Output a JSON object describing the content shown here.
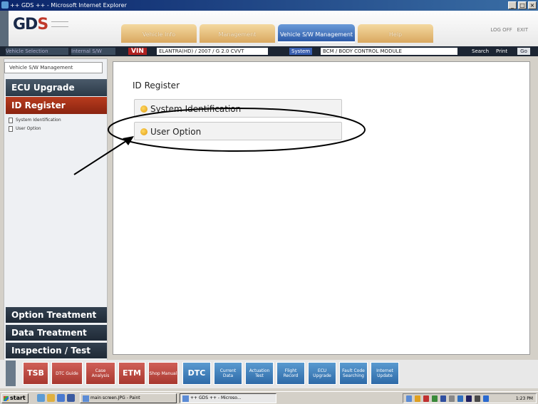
{
  "window": {
    "title": "++ GDS ++ - Microsoft Internet Explorer",
    "buttons": [
      "_",
      "□",
      "×"
    ]
  },
  "header": {
    "logo": "GDS",
    "tabs": [
      {
        "label": "Vehicle Info",
        "active": false
      },
      {
        "label": "Management",
        "active": false
      },
      {
        "label": "Vehicle S/W Management",
        "active": true
      },
      {
        "label": "Help",
        "active": false
      }
    ],
    "logoff": "LOG OFF",
    "exit": "EXIT"
  },
  "infobar": {
    "left1": "Vehicle Selection",
    "left2": "Internal S/W",
    "vin_label": "VIN",
    "vin_value": "ELANTRA(HD) / 2007 / G 2.0 CVVT",
    "system_label": "System",
    "system_value": "BCM / BODY CONTROL MODULE",
    "search": "Search",
    "print": "Print",
    "zoom": "Go"
  },
  "sidebar": {
    "section_title": "Vehicle S/W Management",
    "items": [
      {
        "label": "ECU Upgrade",
        "active": false
      },
      {
        "label": "ID Register",
        "active": true
      }
    ],
    "subitems": [
      "System Identification",
      "User Option"
    ],
    "bottom_items": [
      "Option Treatment",
      "Data Treatment",
      "Inspection / Test"
    ]
  },
  "main": {
    "title": "ID Register",
    "options": [
      "System Identification",
      "User Option"
    ]
  },
  "toolbar": {
    "red_buttons": [
      {
        "label": "TSB",
        "big": true
      },
      {
        "label": "DTC Guide",
        "big": false
      },
      {
        "label": "Case Analysis",
        "big": false
      },
      {
        "label": "ETM",
        "big": true
      },
      {
        "label": "Shop Manual",
        "big": false
      }
    ],
    "blue_buttons": [
      {
        "label": "DTC",
        "big": true
      },
      {
        "label": "Current Data",
        "big": false
      },
      {
        "label": "Actuation Test",
        "big": false
      },
      {
        "label": "Flight Record",
        "big": false
      },
      {
        "label": "ECU Upgrade",
        "big": false
      },
      {
        "label": "Fault Code Searching",
        "big": false
      },
      {
        "label": "Internet Update",
        "big": false
      }
    ]
  },
  "taskbar": {
    "start": "start",
    "tasks": [
      "main screen.JPG - Paint",
      "++ GDS ++ - Microso..."
    ],
    "clock": "1:23 PM"
  },
  "colors": {
    "accent_red": "#a83830",
    "accent_blue": "#2e6aa8",
    "sidebar_dark": "#2b3a48"
  }
}
